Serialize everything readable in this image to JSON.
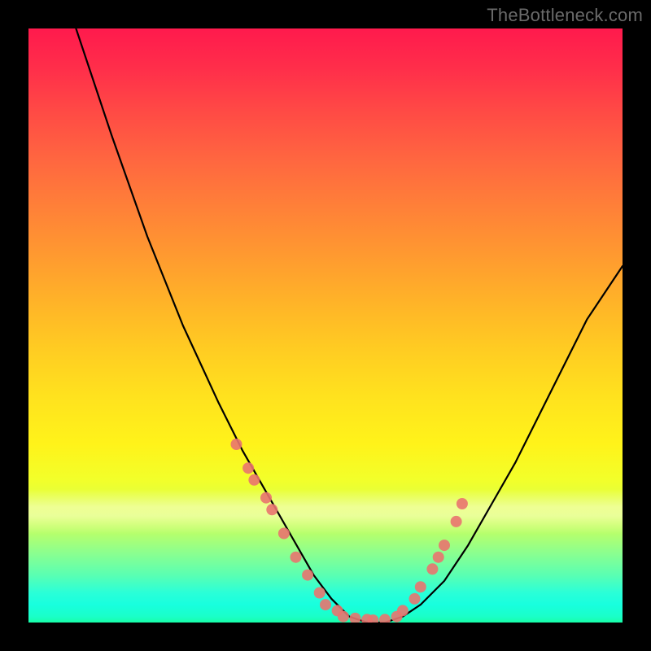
{
  "watermark": "TheBottleneck.com",
  "chart_data": {
    "type": "line",
    "title": "",
    "xlabel": "",
    "ylabel": "",
    "xlim": [
      0,
      100
    ],
    "ylim": [
      0,
      100
    ],
    "grid": false,
    "legend": false,
    "series": [
      {
        "name": "black-curve",
        "x": [
          8,
          14,
          20,
          26,
          32,
          36,
          40,
          44,
          48,
          51,
          54,
          57,
          60,
          63,
          66,
          70,
          74,
          78,
          82,
          86,
          90,
          94,
          98,
          100
        ],
        "y": [
          100,
          82,
          65,
          50,
          37,
          29,
          22,
          15,
          8,
          4,
          1,
          0,
          0,
          1,
          3,
          7,
          13,
          20,
          27,
          35,
          43,
          51,
          57,
          60
        ]
      },
      {
        "name": "red-dots",
        "x": [
          35,
          37,
          38,
          40,
          41,
          43,
          45,
          47,
          49,
          50,
          52,
          53,
          55,
          57,
          58,
          60,
          62,
          63,
          65,
          66,
          68,
          69,
          70,
          72,
          73
        ],
        "y": [
          30,
          26,
          24,
          21,
          19,
          15,
          11,
          8,
          5,
          3,
          2,
          1,
          0.7,
          0.5,
          0.4,
          0.5,
          1,
          2,
          4,
          6,
          9,
          11,
          13,
          17,
          20
        ]
      }
    ]
  }
}
